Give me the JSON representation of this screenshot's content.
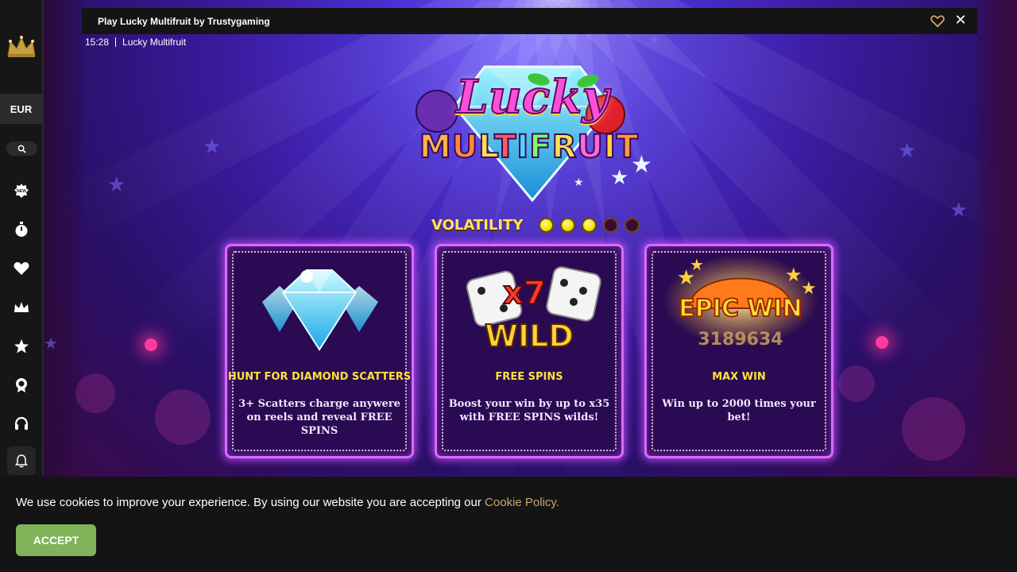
{
  "window": {
    "title": "Play Lucky Multifruit by Trustygaming",
    "time": "15:28",
    "game_name": "Lucky Multifruit"
  },
  "sidebar": {
    "currency": "EUR",
    "icons": [
      "crown-logo-icon",
      "search-icon",
      "new-badge-icon",
      "stopwatch-icon",
      "heart-icon",
      "crown-icon",
      "star-icon",
      "trophy-icon",
      "headset-icon",
      "bell-icon"
    ]
  },
  "game": {
    "logo_line1": "Lucky",
    "logo_line2_letters": [
      "M",
      "U",
      "L",
      "T",
      "I",
      "F",
      "R",
      "U",
      "I",
      "T"
    ],
    "logo_line2_colors": [
      "#ffb347",
      "#ff8a3d",
      "#ffe14a",
      "#ff5a5a",
      "#4ad4ff",
      "#7cff6a",
      "#ffe14a",
      "#ff6ad5",
      "#ffd23f",
      "#ff9a3d"
    ],
    "volatility_label": "VOLATILITY",
    "volatility_level": 3,
    "volatility_max": 5,
    "cards": [
      {
        "title": "HUNT FOR DIAMOND SCATTERS",
        "description": "3+ Scatters charge anywere on reels and reveal FREE SPINS",
        "art": "diamond-icon"
      },
      {
        "title": "FREE SPINS",
        "description": "Boost your win by up to x35 with FREE SPINS wilds!",
        "art_multiplier": "x7",
        "art_word": "WILD"
      },
      {
        "title": "MAX WIN",
        "description": "Win up to 2000 times your bet!",
        "art_headline": "EPIC WIN",
        "art_number": "3189634"
      }
    ]
  },
  "cookie": {
    "text": "We use cookies to improve your experience. By using our website you are accepting our ",
    "link_text": "Cookie Policy.",
    "accept_label": "ACCEPT"
  },
  "colors": {
    "accent_gold": "#ffe23a",
    "accept_green": "#7fb45a",
    "link_tan": "#c9a86a",
    "card_border": "#d86bff"
  }
}
